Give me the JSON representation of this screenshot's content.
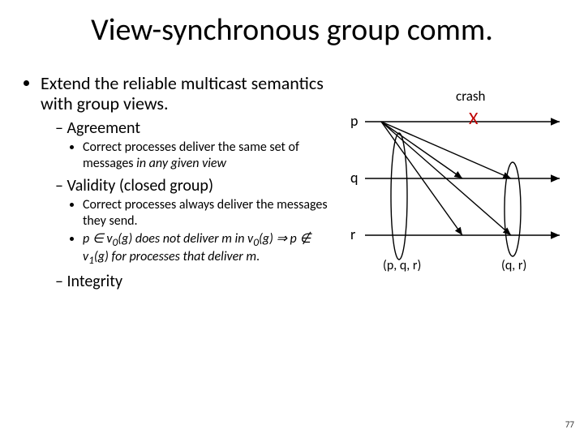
{
  "title": "View-synchronous group comm.",
  "bullets": {
    "extend": "Extend the reliable multicast semantics with group views.",
    "agreement": {
      "label": "Agreement",
      "sub": "Correct processes deliver the same set of messages ",
      "sub_em": "in any given view"
    },
    "validity": {
      "label": "Validity (closed group)",
      "sub1": "Correct processes always deliver the messages they send.",
      "sub2_a": "p ∈ v",
      "sub2_b": "0",
      "sub2_c": "(g) does not deliver ",
      "sub2_d": "m",
      "sub2_e": " in v",
      "sub2_f": "0",
      "sub2_g": "(g) ⇒ p ∉ v",
      "sub2_h": "1",
      "sub2_i": "(g) for processes that deliver ",
      "sub2_j": "m",
      "sub2_k": "."
    },
    "integrity": {
      "label": "Integrity"
    }
  },
  "diagram": {
    "crash_label": "crash",
    "crash_mark": "X",
    "p": "p",
    "q": "q",
    "r": "r",
    "view0": "(p, q, r)",
    "view1": "(q, r)"
  },
  "page": "77"
}
